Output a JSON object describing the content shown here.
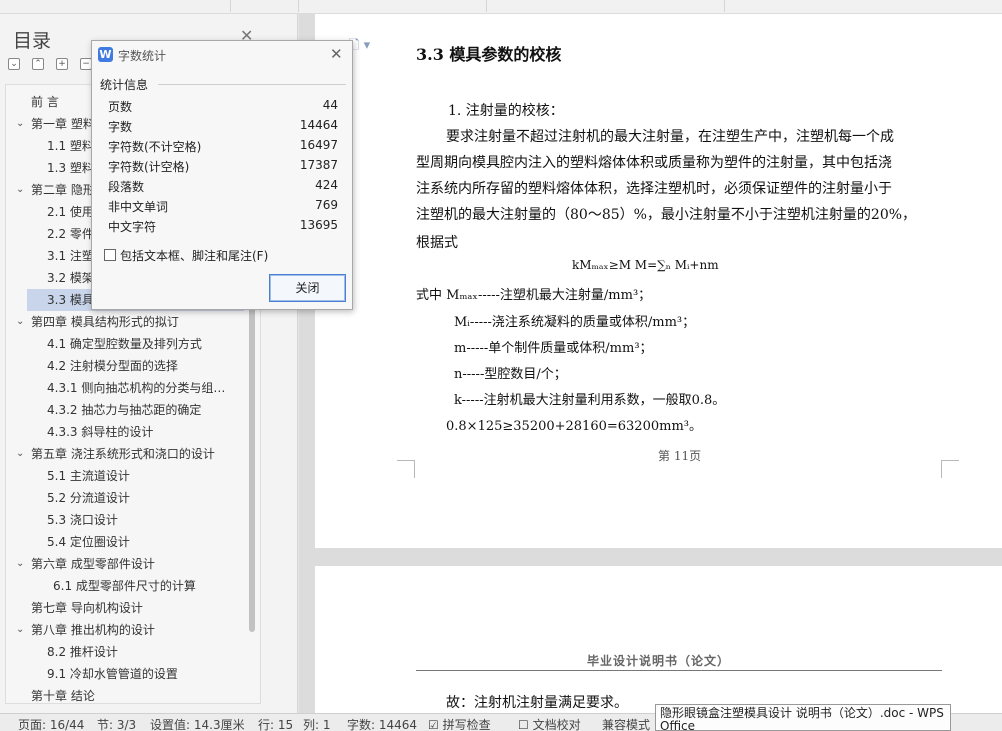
{
  "sidebar": {
    "title": "目录",
    "close_glyph": "✕",
    "toolbar": [
      "⌄",
      "⌃",
      "+",
      "−"
    ],
    "toc": [
      {
        "chev": "",
        "label": "前 言",
        "indent": 1
      },
      {
        "chev": "⌄",
        "label": "第一章 塑料",
        "indent": 1
      },
      {
        "chev": "",
        "label": "1.1  塑料",
        "indent": 2
      },
      {
        "chev": "",
        "label": "1.3  塑料",
        "indent": 2
      },
      {
        "chev": "⌄",
        "label": "第二章 隐形",
        "indent": 1
      },
      {
        "chev": "",
        "label": "2.1  使用",
        "indent": 2
      },
      {
        "chev": "",
        "label": "2.2  零件",
        "indent": 2
      },
      {
        "chev": "",
        "label": "3.1  注塑",
        "indent": 2
      },
      {
        "chev": "",
        "label": "3.2  模架",
        "indent": 2
      },
      {
        "chev": "",
        "label": "3.3  模具",
        "indent": 2,
        "selected": true
      },
      {
        "chev": "⌄",
        "label": "第四章  模具结构形式的拟订",
        "indent": 1
      },
      {
        "chev": "",
        "label": "4.1  确定型腔数量及排列方式",
        "indent": 2
      },
      {
        "chev": "",
        "label": "4.2  注射模分型面的选择",
        "indent": 2
      },
      {
        "chev": "",
        "label": "4.3.1  侧向抽芯机构的分类与组…",
        "indent": 2
      },
      {
        "chev": "",
        "label": "4.3.2  抽芯力与抽芯距的确定",
        "indent": 2
      },
      {
        "chev": "",
        "label": "4.3.3  斜导柱的设计",
        "indent": 2
      },
      {
        "chev": "⌄",
        "label": "第五章  浇注系统形式和浇口的设计",
        "indent": 1
      },
      {
        "chev": "",
        "label": "5.1  主流道设计",
        "indent": 2
      },
      {
        "chev": "",
        "label": "5.2  分流道设计",
        "indent": 2
      },
      {
        "chev": "",
        "label": "5.3  浇口设计",
        "indent": 2
      },
      {
        "chev": "",
        "label": "5.4  定位圈设计",
        "indent": 2
      },
      {
        "chev": "⌄",
        "label": "第六章  成型零部件设计",
        "indent": 1
      },
      {
        "chev": "",
        "label": "6.1  成型零部件尺寸的计算",
        "indent": 3
      },
      {
        "chev": "",
        "label": "第七章  导向机构设计",
        "indent": 1
      },
      {
        "chev": "⌄",
        "label": "第八章  推出机构的设计",
        "indent": 1
      },
      {
        "chev": "",
        "label": "8.2  推杆设计",
        "indent": 2
      },
      {
        "chev": "",
        "label": "9.1  冷却水管管道的设置",
        "indent": 2
      },
      {
        "chev": "",
        "label": "第十章  结论",
        "indent": 1
      }
    ]
  },
  "dialog": {
    "logo": "W",
    "title": "字数统计",
    "close_glyph": "✕",
    "section": "统计信息",
    "stats": [
      {
        "label": "页数",
        "value": "44"
      },
      {
        "label": "字数",
        "value": "14464"
      },
      {
        "label": "字符数(不计空格)",
        "value": "16497"
      },
      {
        "label": "字符数(计空格)",
        "value": "17387"
      },
      {
        "label": "段落数",
        "value": "424"
      },
      {
        "label": "非中文单词",
        "value": "769"
      },
      {
        "label": "中文字符",
        "value": "13695"
      }
    ],
    "checkbox_label": "包括文本框、脚注和尾注(F)",
    "ok_label": "关闭"
  },
  "doc": {
    "page_icon": "🗋 ▾",
    "heading": "3.3  模具参数的校核",
    "item1": "1.  注射量的校核：",
    "para": [
      "要求注射量不超过注射机的最大注射量，在注塑生产中，注塑机每一个成",
      "型周期向模具腔内注入的塑料熔体体积或质量称为塑件的注射量，其中包括浇",
      "注系统内所存留的塑料熔体体积，选择注塑机时，必须保证塑件的注射量小于",
      "注塑机的最大注射量的（80～85）%，最小注射量不小于注塑机注射量的20%，",
      "根据式"
    ],
    "formula": "kMₘₐₓ≥M  M=∑ₙ  Mᵢ+nm",
    "defs": [
      "式中  Mₘₐₓ-----注塑机最大注射量/mm³；",
      "Mᵢ-----浇注系统凝料的质量或体积/mm³；",
      "m-----单个制件质量或体积/mm³；",
      "n-----型腔数目/个；",
      "k-----注射机最大注射量利用系数，一般取0.8。"
    ],
    "calc": "0.8×125≥35200+28160=63200mm³。",
    "page_num": "第 11页",
    "p2_header": "毕业设计说明书（论文）",
    "p2_text": "故：注射机注射量满足要求。"
  },
  "status": {
    "page": "页面: 16/44",
    "section": "节: 3/3",
    "setting": "设置值: 14.3厘米",
    "line": "行: 15",
    "col": "列: 1",
    "words": "字数: 14464",
    "spell": "☑ 拼写检查",
    "proof": "☐ 文档校对",
    "compat": "兼容模式",
    "tooltip": "隐形眼镜盒注塑模具设计 说明书（论文）.doc - WPS Office"
  }
}
